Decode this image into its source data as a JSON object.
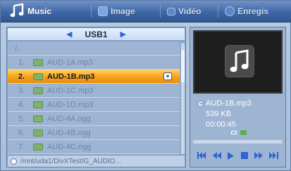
{
  "tabs": [
    {
      "label": "Music",
      "icon": "music-note-icon",
      "active": true
    },
    {
      "label": "Image",
      "icon": "image-icon",
      "active": false
    },
    {
      "label": "Vidéo",
      "icon": "video-icon",
      "active": false
    },
    {
      "label": "Enregis",
      "icon": "record-icon",
      "active": false
    }
  ],
  "browser": {
    "folder": "USB1",
    "prev_arrow": "◀",
    "next_arrow": "▶",
    "parent": "/..",
    "files": [
      {
        "num": "1.",
        "name": "AUD-1A.mp3"
      },
      {
        "num": "2.",
        "name": "AUD-1B.mp3",
        "selected": true,
        "favorite": true
      },
      {
        "num": "3.",
        "name": "AUD-1C.mp3"
      },
      {
        "num": "4.",
        "name": "AUD-1D.mp3"
      },
      {
        "num": "5.",
        "name": "AUD-4A.ogg"
      },
      {
        "num": "6.",
        "name": "AUD-4B.ogg"
      },
      {
        "num": "7.",
        "name": "AUD-4C.ogg"
      }
    ],
    "path": "/mnt/uda1/DivXTest/G_AUDIO..."
  },
  "info": {
    "filename": "AUD-1B.mp3",
    "size": "539 KB",
    "duration": "00:00:45",
    "progress": 0.0
  },
  "colors": {
    "accent_selected": "#f4a21a",
    "tab_bar": "#3f67a6",
    "file_icon": "#7db36a",
    "control_icon": "#2f63d1"
  },
  "controls": [
    "skip-back-icon",
    "rewind-icon",
    "play-icon",
    "stop-icon",
    "fast-forward-icon",
    "skip-forward-icon"
  ]
}
